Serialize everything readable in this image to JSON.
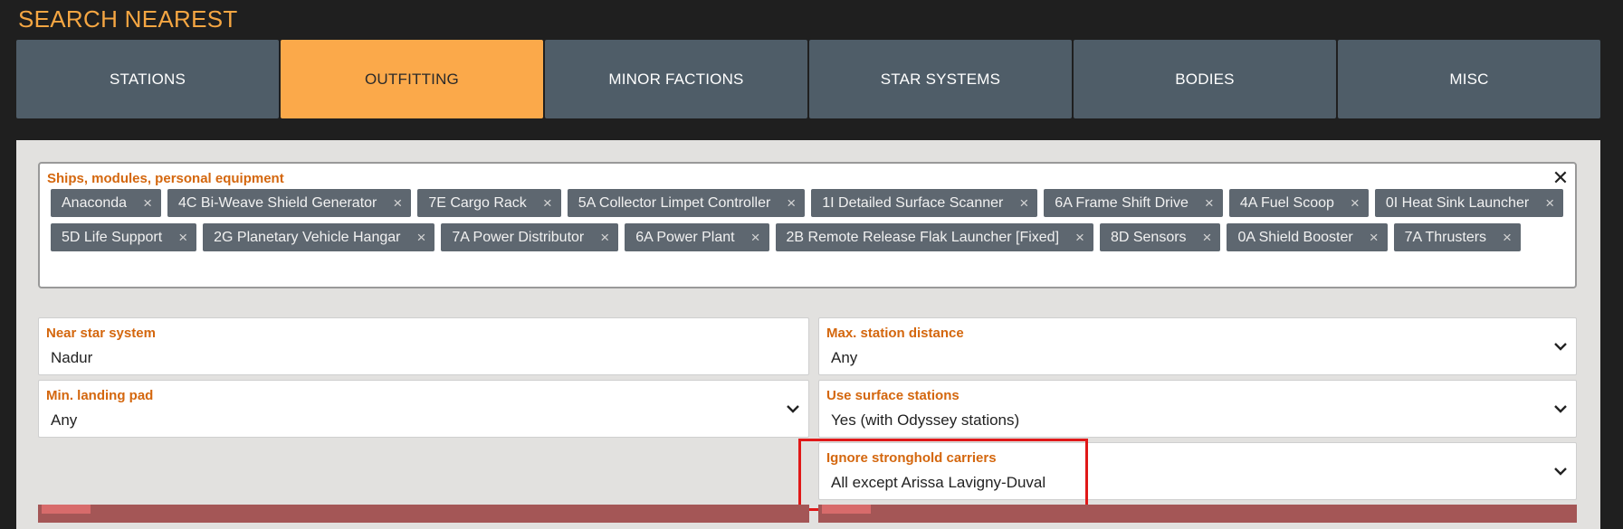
{
  "header": {
    "title": "SEARCH NEAREST"
  },
  "tabs": [
    {
      "label": "STATIONS"
    },
    {
      "label": "OUTFITTING"
    },
    {
      "label": "MINOR FACTIONS"
    },
    {
      "label": "STAR SYSTEMS"
    },
    {
      "label": "BODIES"
    },
    {
      "label": "MISC"
    }
  ],
  "active_tab": "OUTFITTING",
  "equipment": {
    "label": "Ships, modules, personal equipment",
    "clear_symbol": "✕",
    "remove_symbol": "×",
    "tags": [
      "Anaconda",
      "4C Bi-Weave Shield Generator",
      "7E Cargo Rack",
      "5A Collector Limpet Controller",
      "1I Detailed Surface Scanner",
      "6A Frame Shift Drive",
      "4A Fuel Scoop",
      "0I Heat Sink Launcher",
      "5D Life Support",
      "2G Planetary Vehicle Hangar",
      "7A Power Distributor",
      "6A Power Plant",
      "2B Remote Release Flak Launcher [Fixed]",
      "8D Sensors",
      "0A Shield Booster",
      "7A Thrusters"
    ]
  },
  "fields": {
    "near_star_system": {
      "label": "Near star system",
      "value": "Nadur"
    },
    "max_station_distance": {
      "label": "Max. station distance",
      "value": "Any"
    },
    "min_landing_pad": {
      "label": "Min. landing pad",
      "value": "Any"
    },
    "use_surface_stations": {
      "label": "Use surface stations",
      "value": "Yes (with Odyssey stations)"
    },
    "ignore_stronghold_carriers": {
      "label": "Ignore stronghold carriers",
      "value": "All except Arissa Lavigny-Duval"
    }
  },
  "colors": {
    "accent": "#fba94a",
    "label": "#d4670e",
    "tab": "#4f5d68",
    "highlight": "#e01818"
  }
}
